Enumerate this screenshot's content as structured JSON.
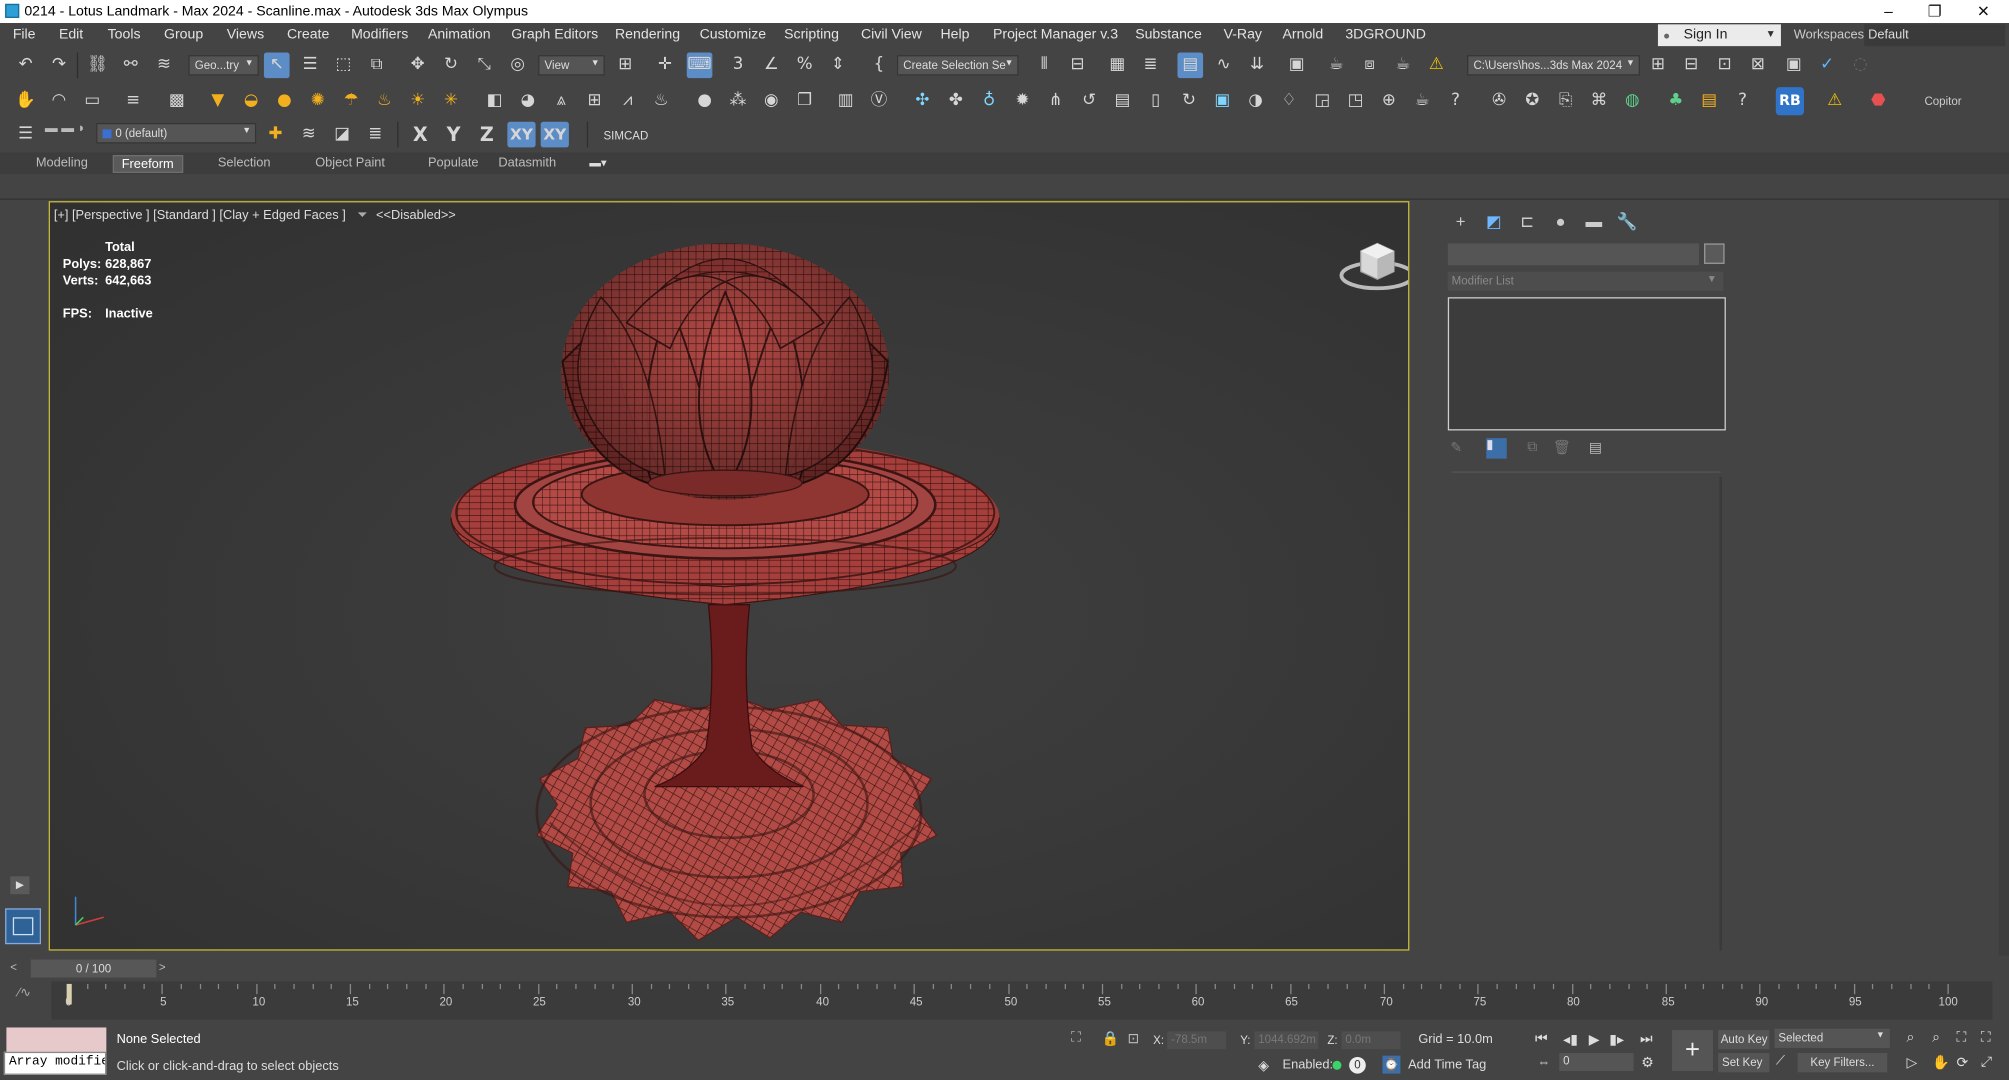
{
  "window": {
    "title": "0214 - Lotus Landmark - Max 2024 - Scanline.max - Autodesk 3ds Max Olympus",
    "minimize_glyph": "–",
    "maximize_glyph": "❐",
    "close_glyph": "✕"
  },
  "menubar": {
    "items": [
      "File",
      "Edit",
      "Tools",
      "Group",
      "Views",
      "Create",
      "Modifiers",
      "Animation",
      "Graph Editors",
      "Rendering",
      "Customize",
      "Scripting",
      "Civil View",
      "Help",
      "Project Manager v.3",
      "Substance",
      "V-Ray",
      "Arnold",
      "3DGROUND"
    ],
    "sign_in": "Sign In",
    "workspaces_label": "Workspaces:",
    "workspace_value": "Default"
  },
  "toolbar1": {
    "selection_filter": "Geo...try",
    "ref_coord": "View",
    "named_selection": "Create Selection Se",
    "project_path": "C:\\Users\\hos...3ds Max 2024"
  },
  "toolbar2": {
    "copitor": "Copitor",
    "rb": "RB"
  },
  "toolbar3": {
    "layer_name": "0 (default)",
    "axis_x": "X",
    "axis_y": "Y",
    "axis_z": "Z",
    "axis_xy": "XY",
    "axis_xy2": "XY",
    "simcad": "SIMCAD"
  },
  "ribbon": {
    "tabs": [
      "Modeling",
      "Freeform",
      "Selection",
      "Object Paint",
      "Populate",
      "Datasmith"
    ],
    "active": "Freeform"
  },
  "viewport": {
    "label": "[+] [Perspective ] [Standard ] [Clay + Edged Faces ]",
    "filter_status": "<<Disabled>>",
    "stats": {
      "header": "Total",
      "polys_label": "Polys:",
      "polys": "628,867",
      "verts_label": "Verts:",
      "verts": "642,663",
      "fps_label": "FPS:",
      "fps": "Inactive"
    }
  },
  "command_panel": {
    "modifier_list": "Modifier List"
  },
  "timeline": {
    "slider": "0 / 100",
    "labels": [
      "0",
      "5",
      "10",
      "15",
      "20",
      "25",
      "30",
      "35",
      "40",
      "45",
      "50",
      "55",
      "60",
      "65",
      "70",
      "75",
      "80",
      "85",
      "90",
      "95",
      "100"
    ]
  },
  "statusbar": {
    "selection": "None Selected",
    "prompt": "Click or click-and-drag to select objects",
    "maxscript": "Array modifie",
    "x_label": "X:",
    "x_value": "-78.5m",
    "y_label": "Y:",
    "y_value": "1044.692m",
    "z_label": "Z:",
    "z_value": "0.0m",
    "grid": "Grid = 10.0m",
    "enabled": "Enabled:",
    "add_time_tag": "Add Time Tag",
    "auto_key": "Auto Key",
    "set_key": "Set Key",
    "selected": "Selected",
    "key_filters": "Key Filters...",
    "frame": "0"
  },
  "colors": {
    "ui_bg": "#444444",
    "viewport_border": "#c9b938",
    "active_blue": "#5d8dc6",
    "model_red": "#b54a46"
  }
}
